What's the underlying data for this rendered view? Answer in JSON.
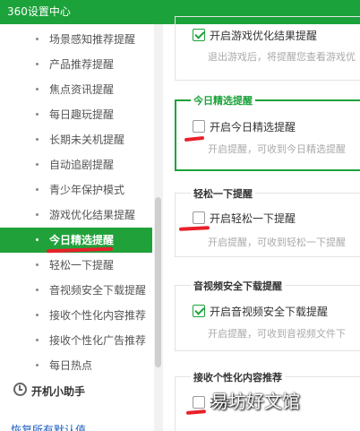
{
  "window": {
    "title": "360设置中心"
  },
  "sidebar": {
    "items": [
      {
        "label": "场景感知推荐提醒"
      },
      {
        "label": "产品推荐提醒"
      },
      {
        "label": "焦点资讯提醒"
      },
      {
        "label": "每日趣玩提醒"
      },
      {
        "label": "长期未关机提醒"
      },
      {
        "label": "自动追剧提醒"
      },
      {
        "label": "青少年保护模式"
      },
      {
        "label": "游戏优化结果提醒"
      },
      {
        "label": "今日精选提醒",
        "active": true
      },
      {
        "label": "轻松一下提醒"
      },
      {
        "label": "音视频安全下载提醒"
      },
      {
        "label": "接收个性化内容推荐"
      },
      {
        "label": "接收个性化广告推荐"
      },
      {
        "label": "每日热点"
      }
    ],
    "assistant_label": "开机小助手",
    "restore_label": "恢复所有默认值"
  },
  "sections": {
    "game": {
      "option": "开启游戏优化结果提醒",
      "checked": true,
      "desc": "退出游戏后，将提醒您查看游戏优"
    },
    "daily": {
      "title": "今日精选提醒",
      "option": "开启今日精选提醒",
      "checked": false,
      "desc": "开启提醒，可收到今日精选提醒"
    },
    "relax": {
      "title": "轻松一下提醒",
      "option": "开启轻松一下提醒",
      "checked": false,
      "desc": "开启提醒，可收到轻松一下提醒"
    },
    "media": {
      "title": "音视频安全下载提醒",
      "option": "开启音视频安全下载提醒",
      "checked": true,
      "desc": "开启提醒，可收到音视频文件下"
    },
    "personal": {
      "title": "接收个性化内容推荐",
      "option": "开启"
    }
  },
  "watermark": "易坊好文馆",
  "colors": {
    "brand": "#1ca23a",
    "marker": "#e8202a"
  }
}
